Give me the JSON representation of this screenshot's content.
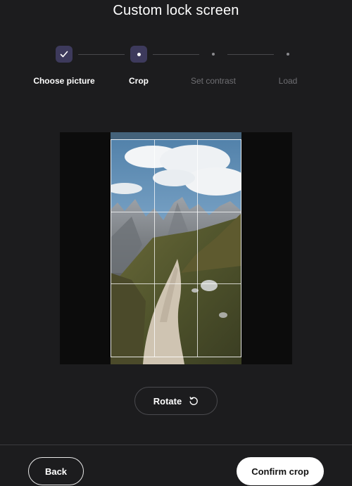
{
  "header": {
    "title": "Custom lock screen"
  },
  "stepper": {
    "steps": [
      {
        "label": "Choose picture",
        "state": "done"
      },
      {
        "label": "Crop",
        "state": "current"
      },
      {
        "label": "Set contrast",
        "state": "pending"
      },
      {
        "label": "Load",
        "state": "pending"
      }
    ]
  },
  "crop": {
    "image_description_icon": "mountain-path-photo"
  },
  "actions": {
    "rotate_label": "Rotate"
  },
  "footer": {
    "back_label": "Back",
    "confirm_label": "Confirm crop"
  },
  "colors": {
    "background": "#1c1c1e",
    "step_marker": "#3d3a5c",
    "primary_button": "#ffffff"
  }
}
